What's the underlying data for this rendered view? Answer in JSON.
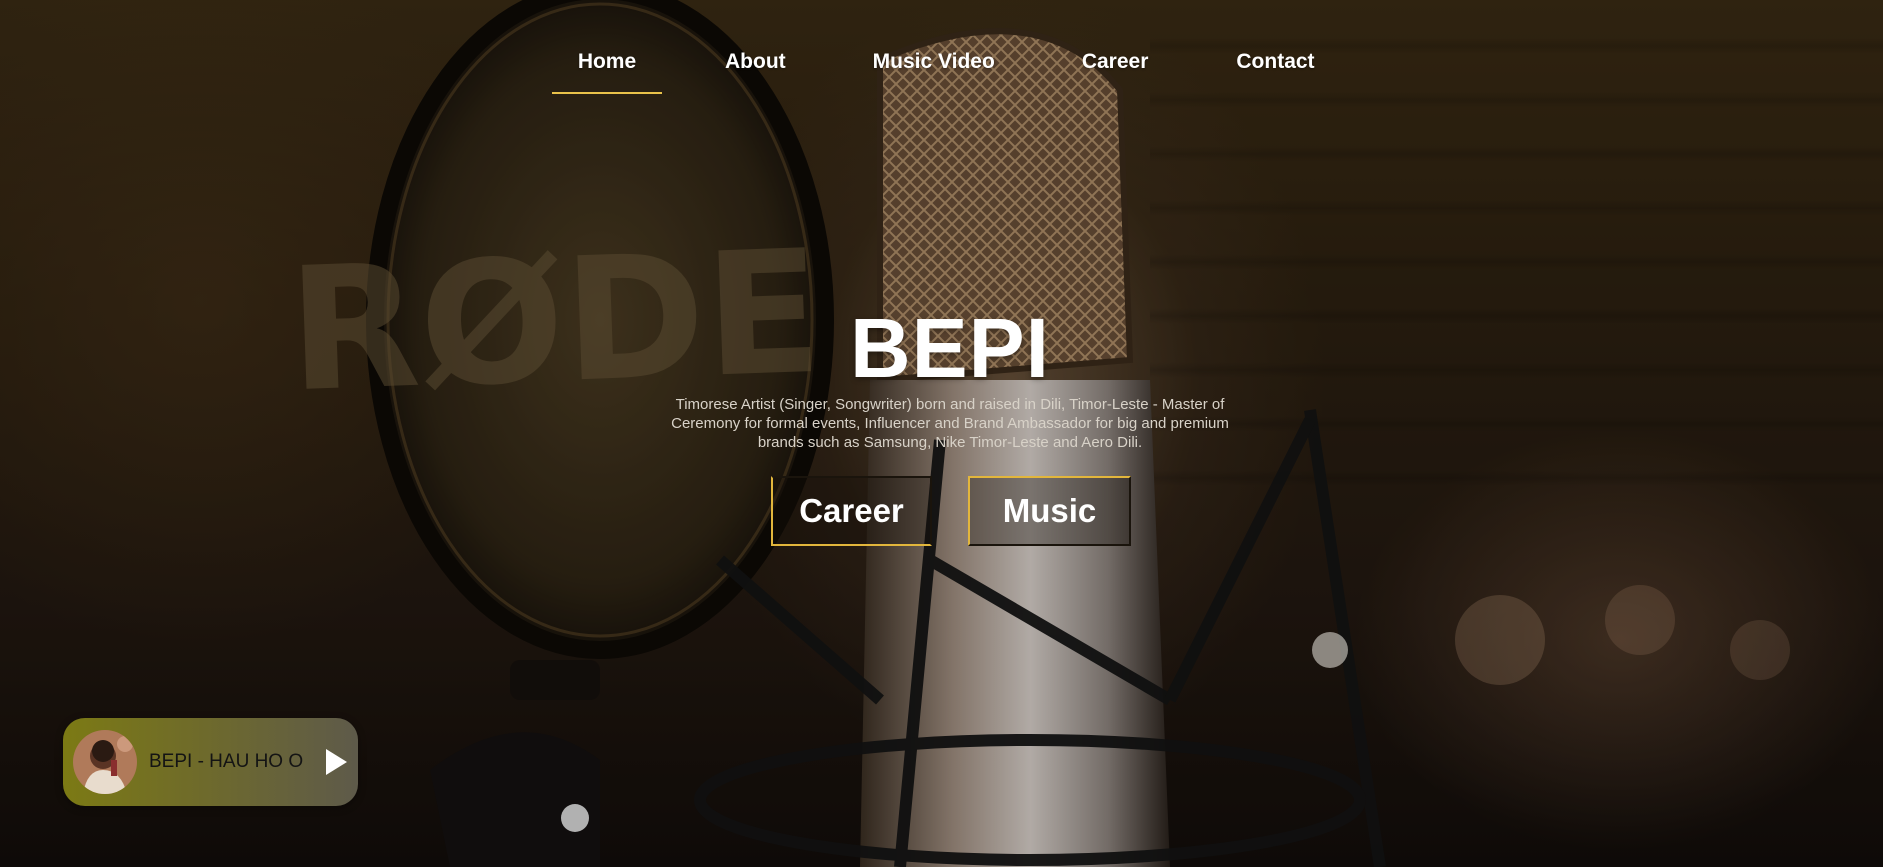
{
  "nav": {
    "items": [
      {
        "label": "Home",
        "active": true
      },
      {
        "label": "About"
      },
      {
        "label": "Music Video"
      },
      {
        "label": "Career"
      },
      {
        "label": "Contact"
      }
    ]
  },
  "hero": {
    "title": "BEPI",
    "description": "Timorese Artist (Singer, Songwriter) born and raised in Dili, Timor-Leste - Master of Ceremony for formal events, Influencer and Brand Ambassador for big and premium brands such as Samsung, Nike Timor-Leste and Aero Dili.",
    "buttons": {
      "career": "Career",
      "music": "Music"
    },
    "background_watermark": "RØDE"
  },
  "player": {
    "track_title": "BEPI - HAU HO O",
    "play_icon": "play-icon"
  },
  "colors": {
    "accent": "#e9c24a",
    "player_bg": "#7c7a14",
    "text": "#ffffff"
  }
}
